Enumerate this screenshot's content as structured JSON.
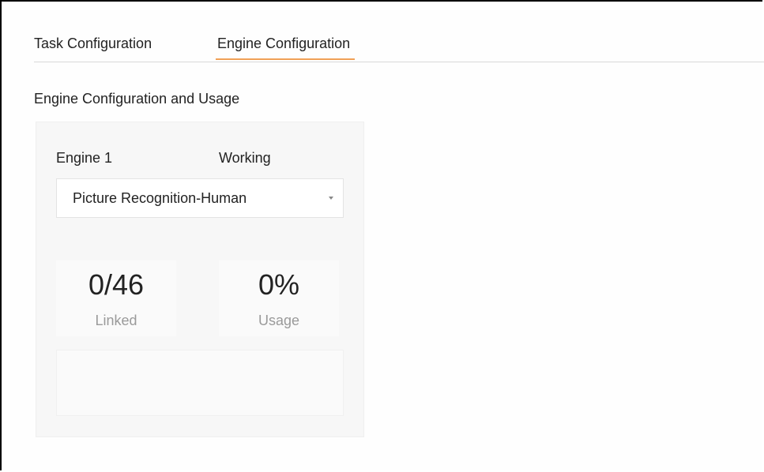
{
  "tabs": [
    {
      "label": "Task Configuration",
      "active": false
    },
    {
      "label": "Engine Configuration",
      "active": true
    }
  ],
  "section": {
    "title": "Engine Configuration and Usage"
  },
  "engine": {
    "name": "Engine 1",
    "status": "Working",
    "mode_selected": "Picture Recognition-Human",
    "caret_icon": "caret-down-icon",
    "linked_value": "0/46",
    "linked_label": "Linked",
    "usage_value": "0%",
    "usage_label": "Usage"
  },
  "colors": {
    "active_tab_underline": "#f0a056",
    "card_background": "#f7f7f7"
  }
}
